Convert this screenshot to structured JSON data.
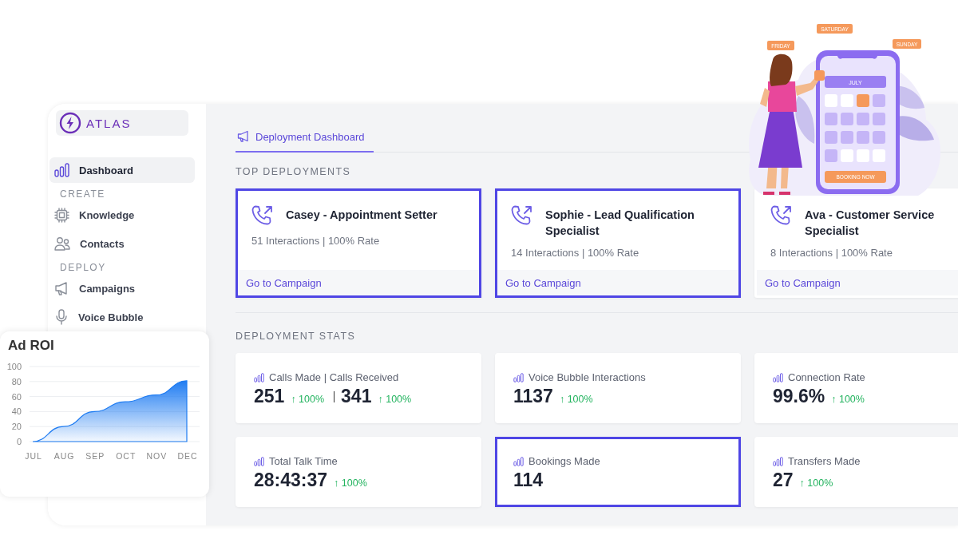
{
  "logo": {
    "text": "ATLAS"
  },
  "sidebar": {
    "items": [
      {
        "kind": "item",
        "label": "Dashboard",
        "selected": true
      },
      {
        "kind": "section",
        "label": "CREATE"
      },
      {
        "kind": "item",
        "label": "Knowledge",
        "selected": false
      },
      {
        "kind": "item",
        "label": "Contacts",
        "selected": false
      },
      {
        "kind": "section",
        "label": "DEPLOY"
      },
      {
        "kind": "item",
        "label": "Campaigns",
        "selected": false
      },
      {
        "kind": "item",
        "label": "Voice Bubble",
        "selected": false
      }
    ]
  },
  "tabs": [
    {
      "label": "Deployment Dashboard",
      "selected": true
    }
  ],
  "top_deployments": {
    "title": "TOP DEPLOYMENTS",
    "cards": [
      {
        "name": "Casey - Appointment Setter",
        "stats": "51 Interactions | 100% Rate",
        "link": "Go to Campaign",
        "selected": true
      },
      {
        "name": "Sophie - Lead Qualification Specialist",
        "stats": "14 Interactions | 100% Rate",
        "link": "Go to Campaign",
        "selected": true
      },
      {
        "name": "Ava - Customer Service Specialist",
        "stats": "8 Interactions | 100% Rate",
        "link": "Go to Campaign",
        "selected": false
      }
    ]
  },
  "deployment_stats": {
    "title": "DEPLOYMENT STATS",
    "cards": [
      {
        "label": "Calls Made | Calls Received",
        "selected": false,
        "values": [
          {
            "value": "251",
            "change": "↑ 100%"
          },
          {
            "value": "341",
            "change": "↑ 100%"
          }
        ]
      },
      {
        "label": "Voice Bubble Interactions",
        "selected": false,
        "values": [
          {
            "value": "1137",
            "change": "↑ 100%"
          }
        ]
      },
      {
        "label": "Connection Rate",
        "selected": false,
        "values": [
          {
            "value": "99.6%",
            "change": "↑ 100%"
          }
        ]
      },
      {
        "label": "Total Talk Time",
        "selected": false,
        "values": [
          {
            "value": "28:43:37",
            "change": "↑ 100%"
          }
        ]
      },
      {
        "label": "Bookings Made",
        "selected": true,
        "values": [
          {
            "value": "114"
          }
        ]
      },
      {
        "label": "Transfers Made",
        "selected": false,
        "values": [
          {
            "value": "27",
            "change": "↑ 100%"
          }
        ]
      }
    ]
  },
  "ad_roi": {
    "chart_data": {
      "type": "area",
      "title": "Ad ROI",
      "categories": [
        "JUL",
        "AUG",
        "SEP",
        "OCT",
        "NOV",
        "DEC"
      ],
      "series": [
        {
          "color": "#1f7cf2",
          "values": [
            0,
            20,
            40,
            53,
            62,
            81
          ]
        }
      ],
      "grid": true,
      "ylim": [
        0,
        100
      ],
      "yticks": [
        0,
        20,
        40,
        60,
        80,
        100
      ]
    }
  },
  "illustration": {
    "tags": [
      "FRIDAY",
      "SATURDAY",
      "SUNDAY"
    ],
    "month": "JULY",
    "button": "BOOKING NOW"
  }
}
